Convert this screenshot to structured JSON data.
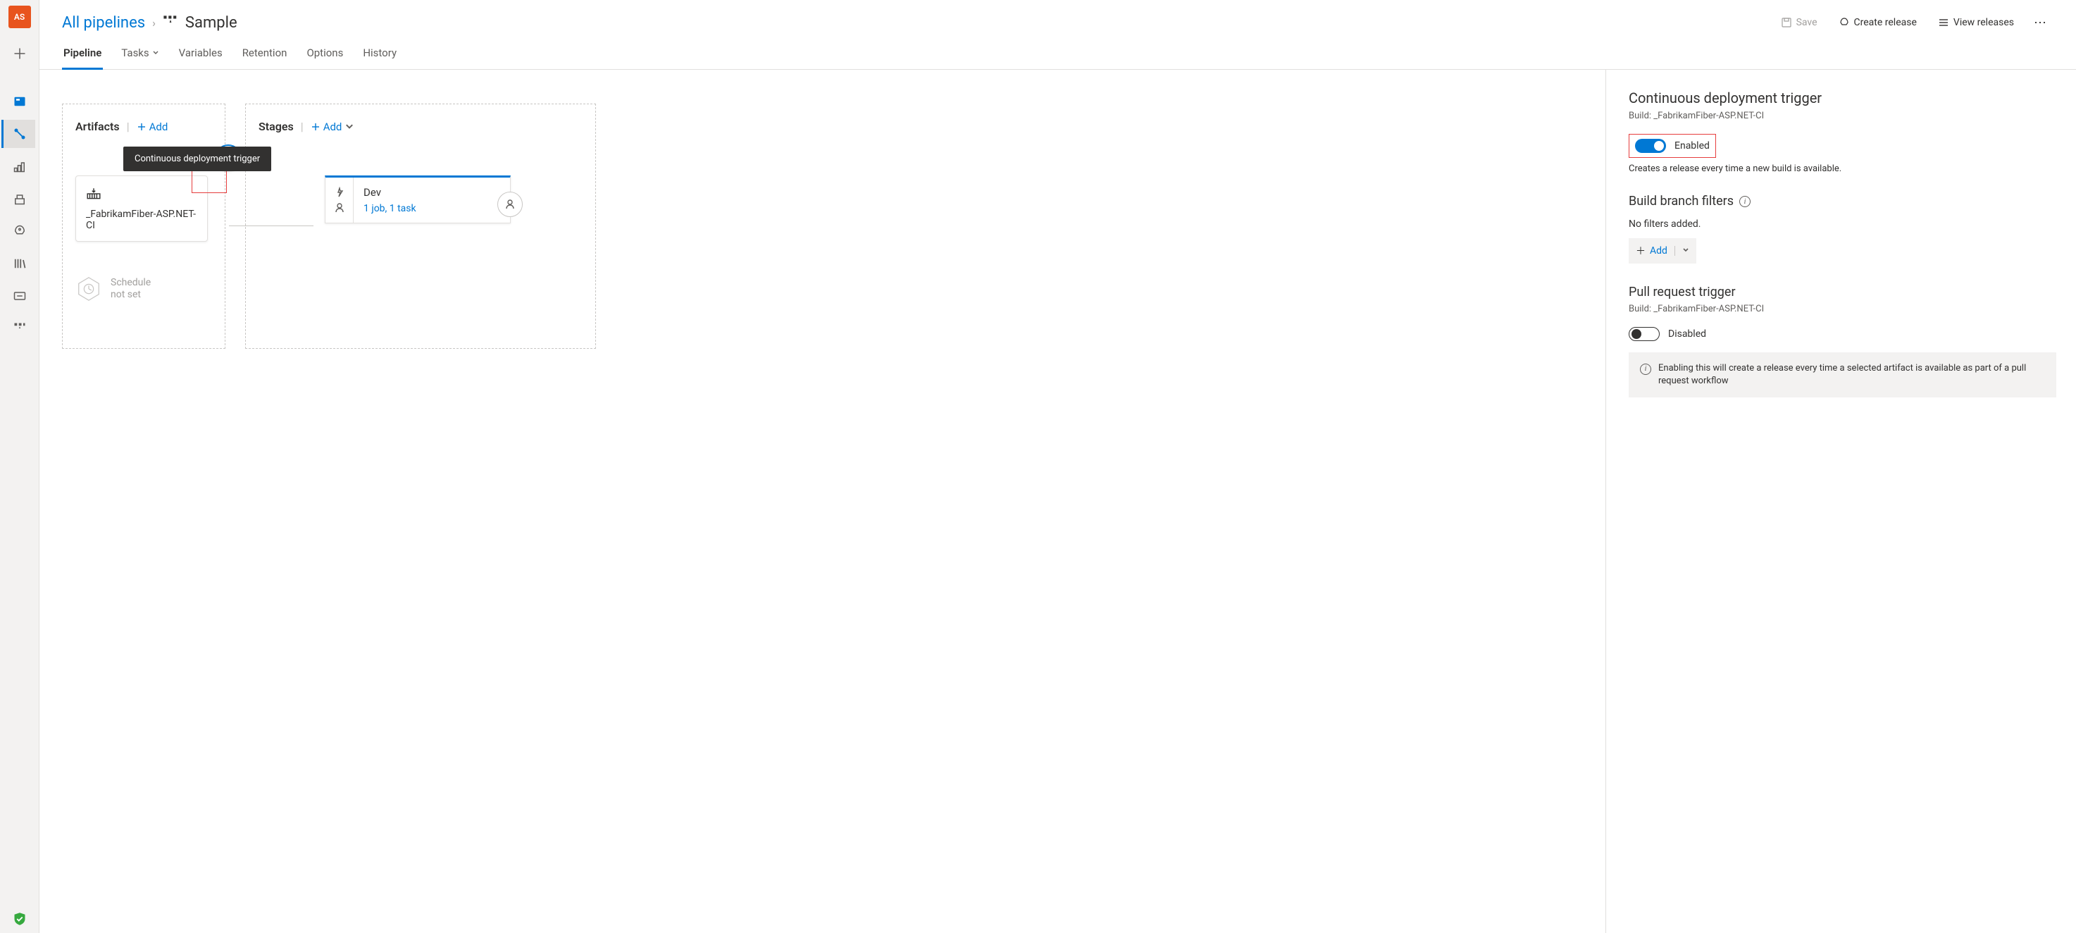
{
  "avatar": {
    "initials": "AS"
  },
  "breadcrumb": {
    "root": "All pipelines",
    "title": "Sample"
  },
  "headerActions": {
    "save": "Save",
    "createRelease": "Create release",
    "viewReleases": "View releases"
  },
  "tabs": {
    "pipeline": "Pipeline",
    "tasks": "Tasks",
    "variables": "Variables",
    "retention": "Retention",
    "options": "Options",
    "history": "History"
  },
  "artifactsPanel": {
    "title": "Artifacts",
    "add": "Add",
    "tooltip": "Continuous deployment trigger",
    "cardName": "_FabrikamFiber-ASP.NET-CI",
    "scheduleL1": "Schedule",
    "scheduleL2": "not set"
  },
  "stagesPanel": {
    "title": "Stages",
    "add": "Add",
    "stageName": "Dev",
    "stageDetail": "1 job, 1 task"
  },
  "rightPane": {
    "cdTitle": "Continuous deployment trigger",
    "cdBuild": "Build: _FabrikamFiber-ASP.NET-CI",
    "enabled": "Enabled",
    "cdHint": "Creates a release every time a new build is available.",
    "branchFiltersTitle": "Build branch filters",
    "noFilters": "No filters added.",
    "addFilter": "Add",
    "prTitle": "Pull request trigger",
    "prBuild": "Build: _FabrikamFiber-ASP.NET-CI",
    "disabled": "Disabled",
    "prHint": "Enabling this will create a release every time a selected artifact is available as part of a pull request workflow"
  }
}
